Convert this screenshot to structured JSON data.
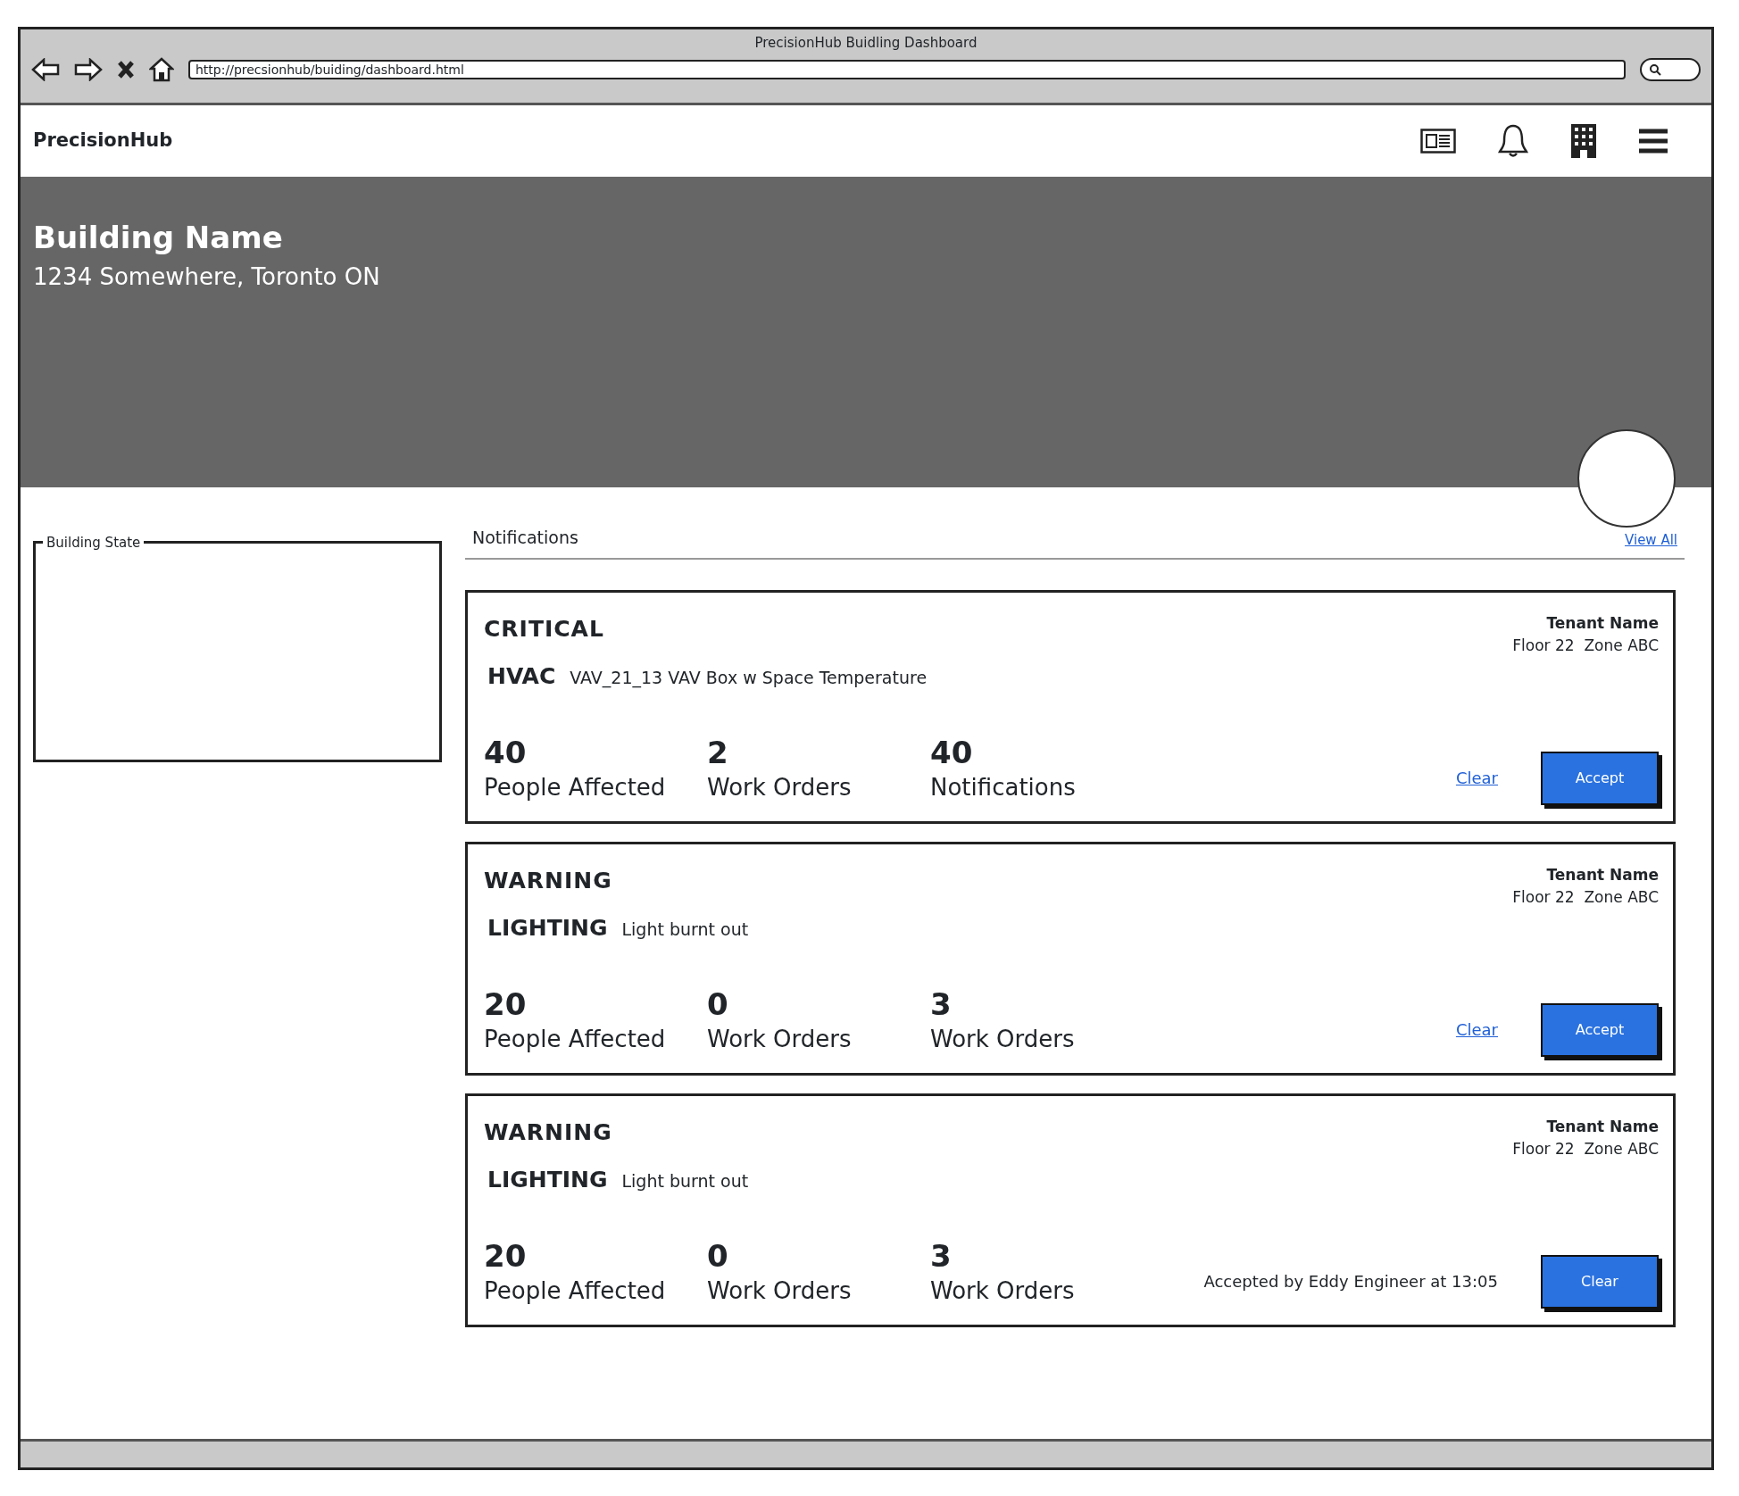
{
  "window": {
    "title": "PrecisionHub Buidling Dashboard",
    "url": "http://precsionhub/buiding/dashboard.html"
  },
  "navbar": {
    "brand": "PrecisionHub"
  },
  "hero": {
    "title": "Building Name",
    "address": "1234 Somewhere, Toronto ON"
  },
  "building_state": {
    "legend": "Building State"
  },
  "notifications": {
    "title": "Notifications",
    "view_all": "View All",
    "items": [
      {
        "severity": "CRITICAL",
        "system": "HVAC",
        "description": "VAV_21_13 VAV Box w Space Temperature",
        "tenant": "Tenant Name",
        "location": "Floor 22  Zone ABC",
        "stats": [
          {
            "value": "40",
            "label": "People Affected"
          },
          {
            "value": "2",
            "label": "Work Orders"
          },
          {
            "value": "40",
            "label": "Notifications"
          }
        ],
        "actions": [
          {
            "kind": "link",
            "text": "Clear"
          },
          {
            "kind": "button",
            "text": "Accept"
          }
        ]
      },
      {
        "severity": "WARNING",
        "system": "LIGHTING",
        "description": "Light burnt out",
        "tenant": "Tenant Name",
        "location": "Floor 22  Zone ABC",
        "stats": [
          {
            "value": "20",
            "label": "People Affected"
          },
          {
            "value": "0",
            "label": "Work Orders"
          },
          {
            "value": "3",
            "label": "Work Orders"
          }
        ],
        "actions": [
          {
            "kind": "link",
            "text": "Clear"
          },
          {
            "kind": "button",
            "text": "Accept"
          }
        ]
      },
      {
        "severity": "WARNING",
        "system": "LIGHTING",
        "description": "Light burnt out",
        "tenant": "Tenant Name",
        "location": "Floor 22  Zone ABC",
        "stats": [
          {
            "value": "20",
            "label": "People Affected"
          },
          {
            "value": "0",
            "label": "Work Orders"
          },
          {
            "value": "3",
            "label": "Work Orders"
          }
        ],
        "actions": [
          {
            "kind": "text",
            "text": "Accepted by Eddy Engineer at 13:05"
          },
          {
            "kind": "button",
            "text": "Clear"
          }
        ]
      }
    ]
  }
}
